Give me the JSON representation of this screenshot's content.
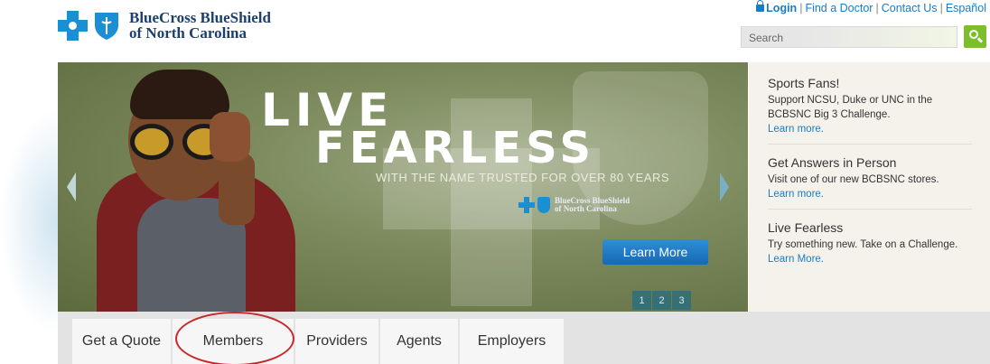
{
  "header": {
    "logo_line1": "BlueCross BlueShield",
    "logo_line2": "of North Carolina",
    "links": [
      "Login",
      "Find a Doctor",
      "Contact Us",
      "Español"
    ],
    "search_placeholder": "Search"
  },
  "hero": {
    "headline1": "LIVE",
    "headline2": "FEARLESS",
    "tagline": "WITH THE NAME TRUSTED FOR OVER 80 YEARS",
    "logo_line1": "BlueCross BlueShield",
    "logo_line2": "of North Carolina",
    "cta": "Learn More",
    "slides": [
      "1",
      "2",
      "3"
    ]
  },
  "promos": [
    {
      "title": "Sports Fans!",
      "body": "Support NCSU, Duke or UNC in the BCBSNC Big 3 Challenge.",
      "link": "Learn more."
    },
    {
      "title": "Get Answers in Person",
      "body": "Visit one of our new BCBSNC stores.",
      "link": "Learn more."
    },
    {
      "title": "Live Fearless",
      "body": "Try something new. Take on a Challenge.",
      "link": "Learn More."
    }
  ],
  "nav": {
    "tabs": [
      "Get a Quote",
      "Members",
      "Providers",
      "Agents",
      "Employers"
    ],
    "highlighted": "Members"
  },
  "colors": {
    "brand_blue": "#1b8fd4",
    "link_blue": "#1b7bc4",
    "search_green": "#7cbf2a",
    "highlight_red": "#c8282c"
  }
}
